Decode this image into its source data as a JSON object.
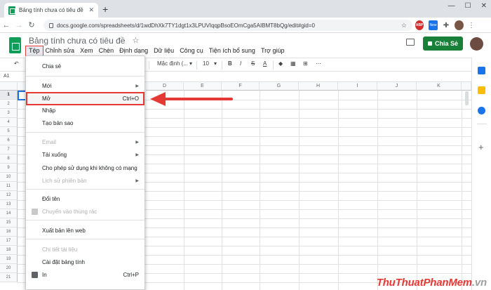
{
  "browser": {
    "tab_title": "Bảng tính chưa có tiêu đề - Goog",
    "url": "docs.google.com/spreadsheets/d/1wdDhXk7TY1dgt1x3LPUVIqqpBsoEOmCga5AIBMT8bQg/edit#gid=0",
    "ext_abp_label": "ABP",
    "ext_new_label": "New"
  },
  "sheet": {
    "doc_title": "Bảng tính chưa có tiêu đề",
    "share_label": "Chia Sẻ",
    "cell_ref": "A1",
    "brand_color": "#0f9d58",
    "share_color": "#188038"
  },
  "menubar": {
    "file": "Tệp",
    "edit": "Chỉnh sửa",
    "view": "Xem",
    "insert": "Chèn",
    "format": "Định dạng",
    "data": "Dữ liệu",
    "tools": "Công cụ",
    "addons": "Tiện ích bổ sung",
    "help": "Trợ giúp"
  },
  "toolbar": {
    "font": "Mặc định (...",
    "font_size": "10",
    "bold": "B",
    "italic": "I",
    "strike": "S",
    "text_color": "A",
    "more": "⋯"
  },
  "grid": {
    "columns": [
      "D",
      "E",
      "F",
      "G",
      "H",
      "I",
      "J",
      "K"
    ],
    "rows": [
      "1",
      "2",
      "3",
      "4",
      "5",
      "6",
      "7",
      "8",
      "9",
      "10",
      "11",
      "12",
      "13",
      "14",
      "15",
      "16",
      "17",
      "18",
      "19",
      "20",
      "21"
    ]
  },
  "file_menu": {
    "share": "Chia sẻ",
    "new": "Mới",
    "open": "Mở",
    "open_shortcut": "Ctrl+O",
    "import": "Nhập",
    "make_copy": "Tạo bản sao",
    "email": "Email",
    "download": "Tải xuống",
    "offline": "Cho phép sử dụng khi không có mạng",
    "version_history": "Lịch sử phiên bản",
    "rename": "Đổi tên",
    "move_to_trash": "Chuyển vào thùng rác",
    "publish": "Xuất bản lên web",
    "doc_details": "Chi tiết tài liệu",
    "settings": "Cài đặt bảng tính",
    "print": "In",
    "print_shortcut": "Ctrl+P"
  },
  "annotation": {
    "highlight_color": "#e53935"
  },
  "watermark": {
    "part1": "ThuThuat",
    "part2": "PhanMem",
    "part3": ".vn"
  }
}
